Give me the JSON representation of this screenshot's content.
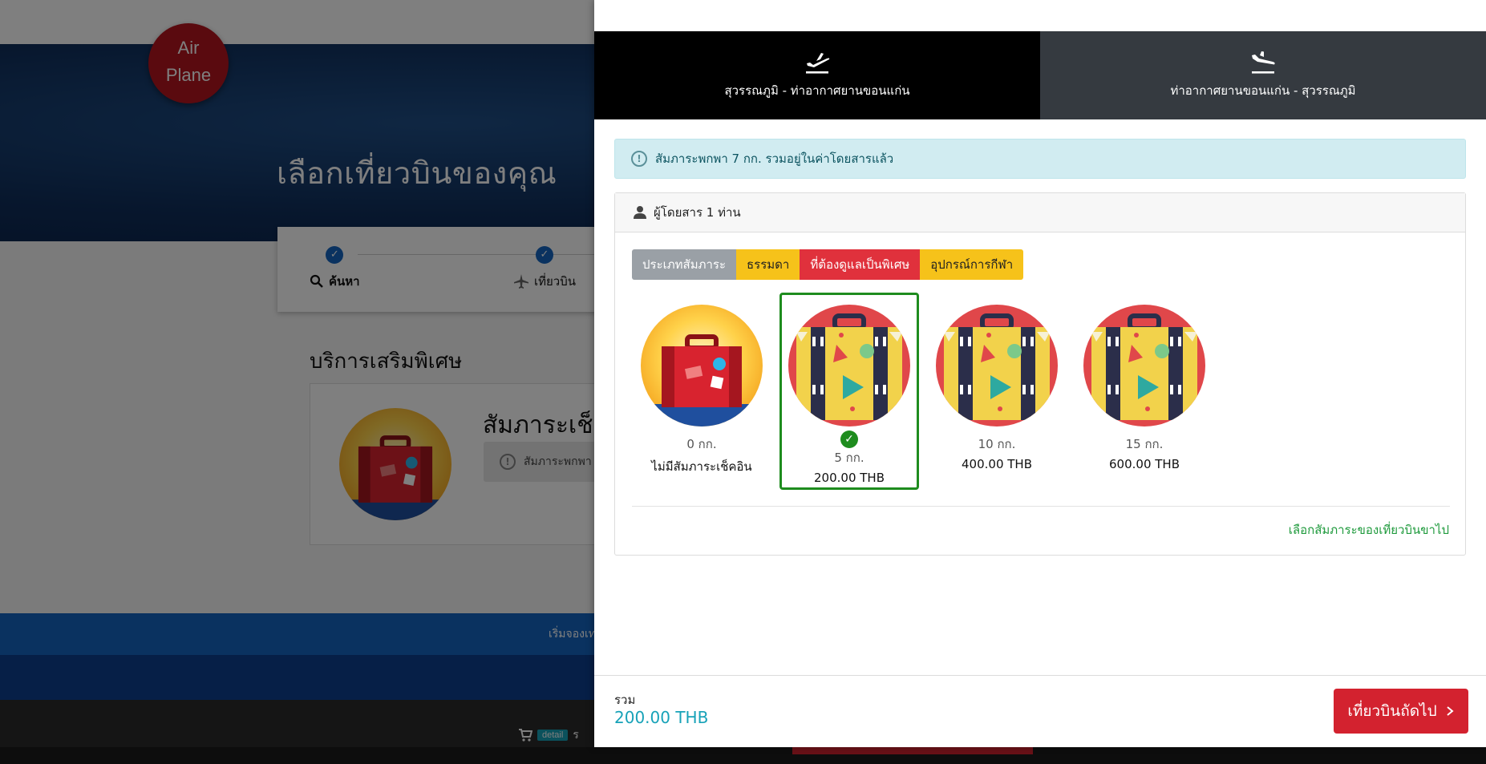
{
  "background": {
    "logo_line1": "Air",
    "logo_line2": "Plane",
    "hero_title": "เลือกเที่ยวบินของคุณ",
    "steps": [
      {
        "label": "ค้นหา",
        "icon": "search-icon"
      },
      {
        "label": "เที่ยวบิน",
        "icon": "plane-icon"
      }
    ],
    "section_title": "บริการเสริมพิเศษ",
    "card_title": "สัมภาระเช็ค",
    "card_alert": "สัมภาระพกพา",
    "footer_text": "เริ่มจองเท",
    "cart_badge": "detail",
    "cart_after": "ร"
  },
  "tabs": [
    {
      "label": "สุวรรณภูมิ - ท่าอากาศยานขอนแก่น",
      "icon": "takeoff-icon",
      "active": true
    },
    {
      "label": "ท่าอากาศยานขอนแก่น - สุวรรณภูมิ",
      "icon": "landing-icon",
      "active": false
    }
  ],
  "info_alert": "สัมภาระพกพา 7 กก. รวมอยู่ในค่าโดยสารแล้ว",
  "passenger_header": "ผู้โดยสาร 1 ท่าน",
  "legend": {
    "type": "ประเภทสัมภาระ",
    "normal": "ธรรมดา",
    "special": "ที่ต้องดูแลเป็นพิเศษ",
    "sport": "อุปกรณ์การกีฬา"
  },
  "options": [
    {
      "weight": "0 กก.",
      "price": "ไม่มีสัมภาระเช็คอิน",
      "selected": false,
      "icon": "suitcase-icon"
    },
    {
      "weight": "5 กก.",
      "price": "200.00 THB",
      "selected": true,
      "icon": "special-luggage-icon"
    },
    {
      "weight": "10 กก.",
      "price": "400.00 THB",
      "selected": false,
      "icon": "special-luggage-icon"
    },
    {
      "weight": "15 กก.",
      "price": "600.00 THB",
      "selected": false,
      "icon": "special-luggage-icon"
    }
  ],
  "next_link": "เลือกสัมภาระของเที่ยวบินขาไป",
  "footer": {
    "total_label": "รวม",
    "total_value": "200.00 THB",
    "next_button": "เที่ยวบินถัดไป"
  },
  "colors": {
    "accent_red": "#d3222f",
    "selected_green": "#1e8c1e",
    "total_teal": "#17a2b8"
  }
}
